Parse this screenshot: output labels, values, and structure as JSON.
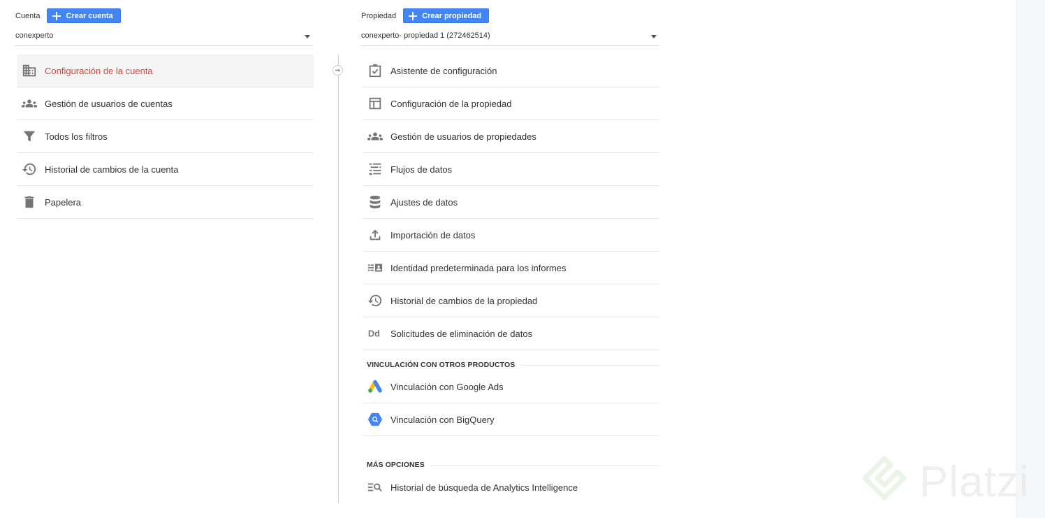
{
  "account": {
    "label": "Cuenta",
    "create_button": "Crear cuenta",
    "selected": "conexperto",
    "items": [
      {
        "label": "Configuración de la cuenta"
      },
      {
        "label": "Gestión de usuarios de cuentas"
      },
      {
        "label": "Todos los filtros"
      },
      {
        "label": "Historial de cambios de la cuenta"
      },
      {
        "label": "Papelera"
      }
    ]
  },
  "property": {
    "label": "Propiedad",
    "create_button": "Crear propiedad",
    "selected": "conexperto- propiedad 1 (272462514)",
    "items": [
      {
        "label": "Asistente de configuración"
      },
      {
        "label": "Configuración de la propiedad"
      },
      {
        "label": "Gestión de usuarios de propiedades"
      },
      {
        "label": "Flujos de datos"
      },
      {
        "label": "Ajustes de datos"
      },
      {
        "label": "Importación de datos"
      },
      {
        "label": "Identidad predeterminada para los informes"
      },
      {
        "label": "Historial de cambios de la propiedad"
      },
      {
        "label": "Solicitudes de eliminación de datos"
      }
    ],
    "linking_section": {
      "title": "VINCULACIÓN CON OTROS PRODUCTOS",
      "items": [
        {
          "label": "Vinculación con Google Ads"
        },
        {
          "label": "Vinculación con BigQuery"
        }
      ]
    },
    "more_section": {
      "title": "MÁS OPCIONES",
      "items": [
        {
          "label": "Historial de búsqueda de Analytics Intelligence"
        }
      ]
    }
  },
  "watermark": "Platzi",
  "colors": {
    "accent": "#4285f4",
    "active_text": "#db4437",
    "icon": "#757575"
  }
}
